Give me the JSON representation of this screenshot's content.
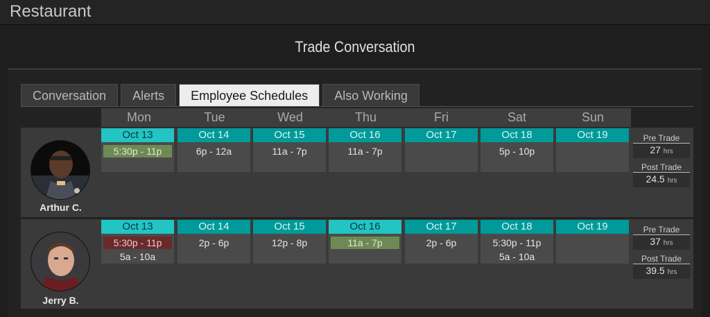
{
  "app": {
    "title": "Restaurant"
  },
  "dialog": {
    "title": "Trade Conversation"
  },
  "tabs": [
    {
      "label": "Conversation",
      "active": false
    },
    {
      "label": "Alerts",
      "active": false
    },
    {
      "label": "Employee Schedules",
      "active": true
    },
    {
      "label": "Also Working",
      "active": false
    }
  ],
  "days": [
    "Mon",
    "Tue",
    "Wed",
    "Thu",
    "Fri",
    "Sat",
    "Sun"
  ],
  "employees": [
    {
      "name": "Arthur C.",
      "avatar_icon": "person-photo",
      "dates": [
        "Oct 13",
        "Oct 14",
        "Oct 15",
        "Oct 16",
        "Oct 17",
        "Oct 18",
        "Oct 19"
      ],
      "shifts": [
        [
          "5:30p - 11p"
        ],
        [
          "6p - 12a"
        ],
        [
          "11a - 7p"
        ],
        [
          "11a - 7p"
        ],
        [],
        [
          "5p - 10p"
        ],
        []
      ],
      "pre_trade_label": "Pre Trade",
      "pre_trade_value": "27",
      "post_trade_label": "Post Trade",
      "post_trade_value": "24.5",
      "unit": "hrs"
    },
    {
      "name": "Jerry B.",
      "avatar_icon": "person-photo",
      "dates": [
        "Oct 13",
        "Oct 14",
        "Oct 15",
        "Oct 16",
        "Oct 17",
        "Oct 18",
        "Oct 19"
      ],
      "shifts": [
        [
          "5:30p - 11p",
          "5a - 10a"
        ],
        [
          "2p - 6p"
        ],
        [
          "12p - 8p"
        ],
        [
          "11a - 7p"
        ],
        [
          "2p - 6p"
        ],
        [
          "5:30p - 11p",
          "5a - 10a"
        ],
        []
      ],
      "pre_trade_label": "Pre Trade",
      "pre_trade_value": "37",
      "post_trade_label": "Post Trade",
      "post_trade_value": "39.5",
      "unit": "hrs"
    }
  ],
  "colors": {
    "date_bar": "#009a9a",
    "date_bar_highlight": "#22c4c4",
    "shift_given": "#6e8a54",
    "shift_taken": "#6a2a2a"
  }
}
